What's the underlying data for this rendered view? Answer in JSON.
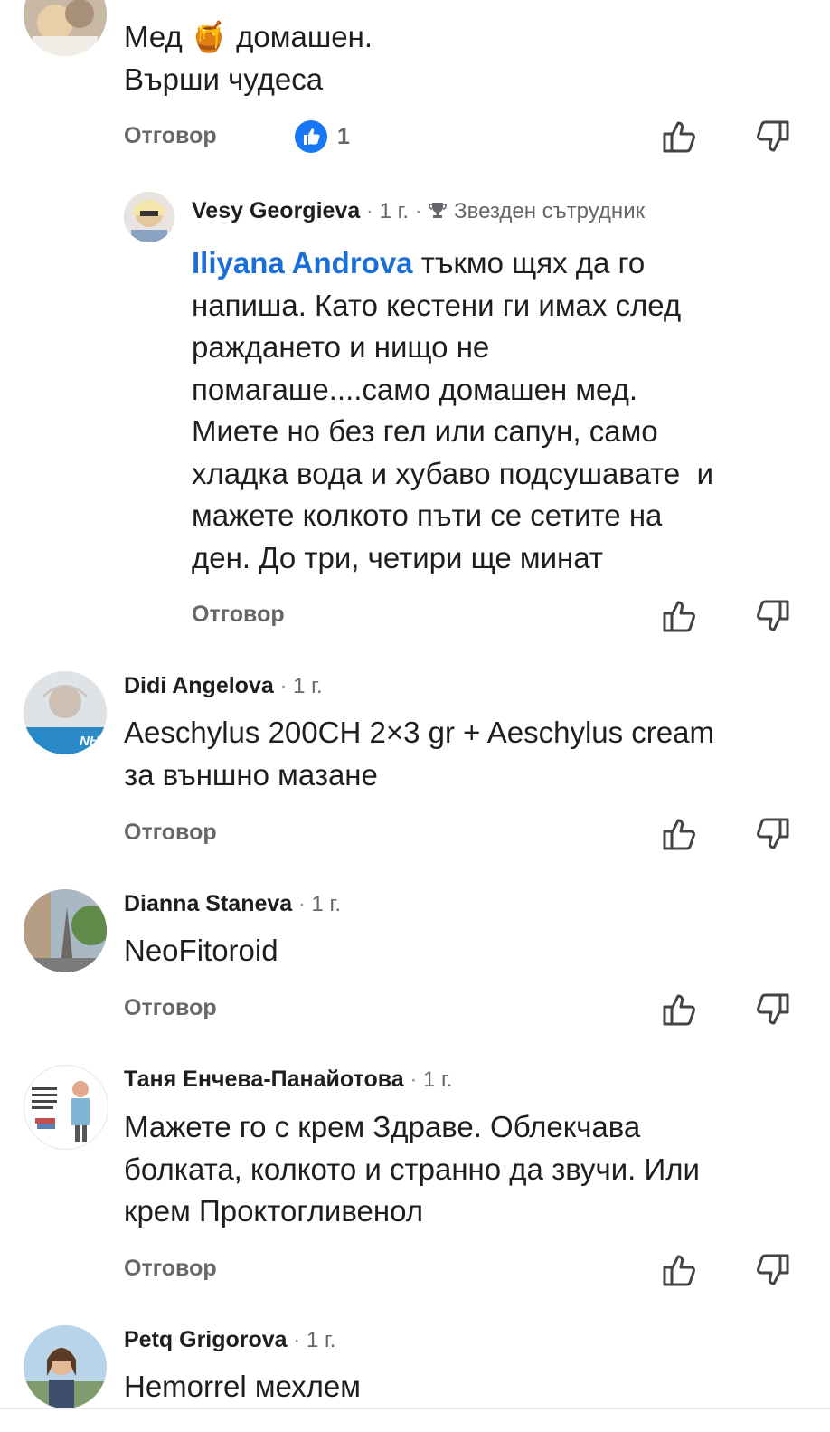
{
  "comments": [
    {
      "author": "",
      "body": [
        "Мед 🍯 домашен.",
        "Върши чудеса"
      ],
      "reply_label": "Отговор",
      "like_count": "1"
    },
    {
      "author": "Vesy Georgieva",
      "time": "1 г.",
      "badge": "Звезден сътрудник",
      "mention": "Iliyana Androva",
      "body": [
        " тъкмо щях да го",
        "напиша. Като кестени ги имах след",
        "раждането и нищо не",
        "помагаше....само домашен мед.",
        "Миете но без гел или сапун, само",
        "хладка вода и хубаво подсушавате  и",
        "мажете колкото пъти се сетите на",
        "ден. До три, четири ще минат"
      ],
      "reply_label": "Отговор"
    },
    {
      "author": "Didi Angelova",
      "time": "1 г.",
      "body": [
        "Aeschylus 200CH 2×3 gr + Aeschylus cream",
        "за външно мазане"
      ],
      "reply_label": "Отговор",
      "avatar_text": "NHS"
    },
    {
      "author": "Dianna Staneva",
      "time": "1 г.",
      "body": [
        "NeoFitoroid"
      ],
      "reply_label": "Отговор"
    },
    {
      "author": "Таня Енчева-Панайотова",
      "time": "1 г.",
      "body": [
        "Мажете го с крем Здраве. Облекчава",
        "болката, колкото и странно да звучи. Или",
        "крем Проктогливенол"
      ],
      "reply_label": "Отговор"
    },
    {
      "author": "Petq Grigorova",
      "time": "1 г.",
      "body": [
        "Hemorrel мехлем"
      ]
    }
  ],
  "icons": {
    "like": "thumbs-up-outline-icon",
    "dislike": "thumbs-down-outline-icon",
    "badge": "trophy-icon",
    "reaction": "like-reaction-icon"
  },
  "colors": {
    "accent": "#1877f2",
    "mention": "#1a6ed8",
    "secondary_text": "#65676b"
  }
}
